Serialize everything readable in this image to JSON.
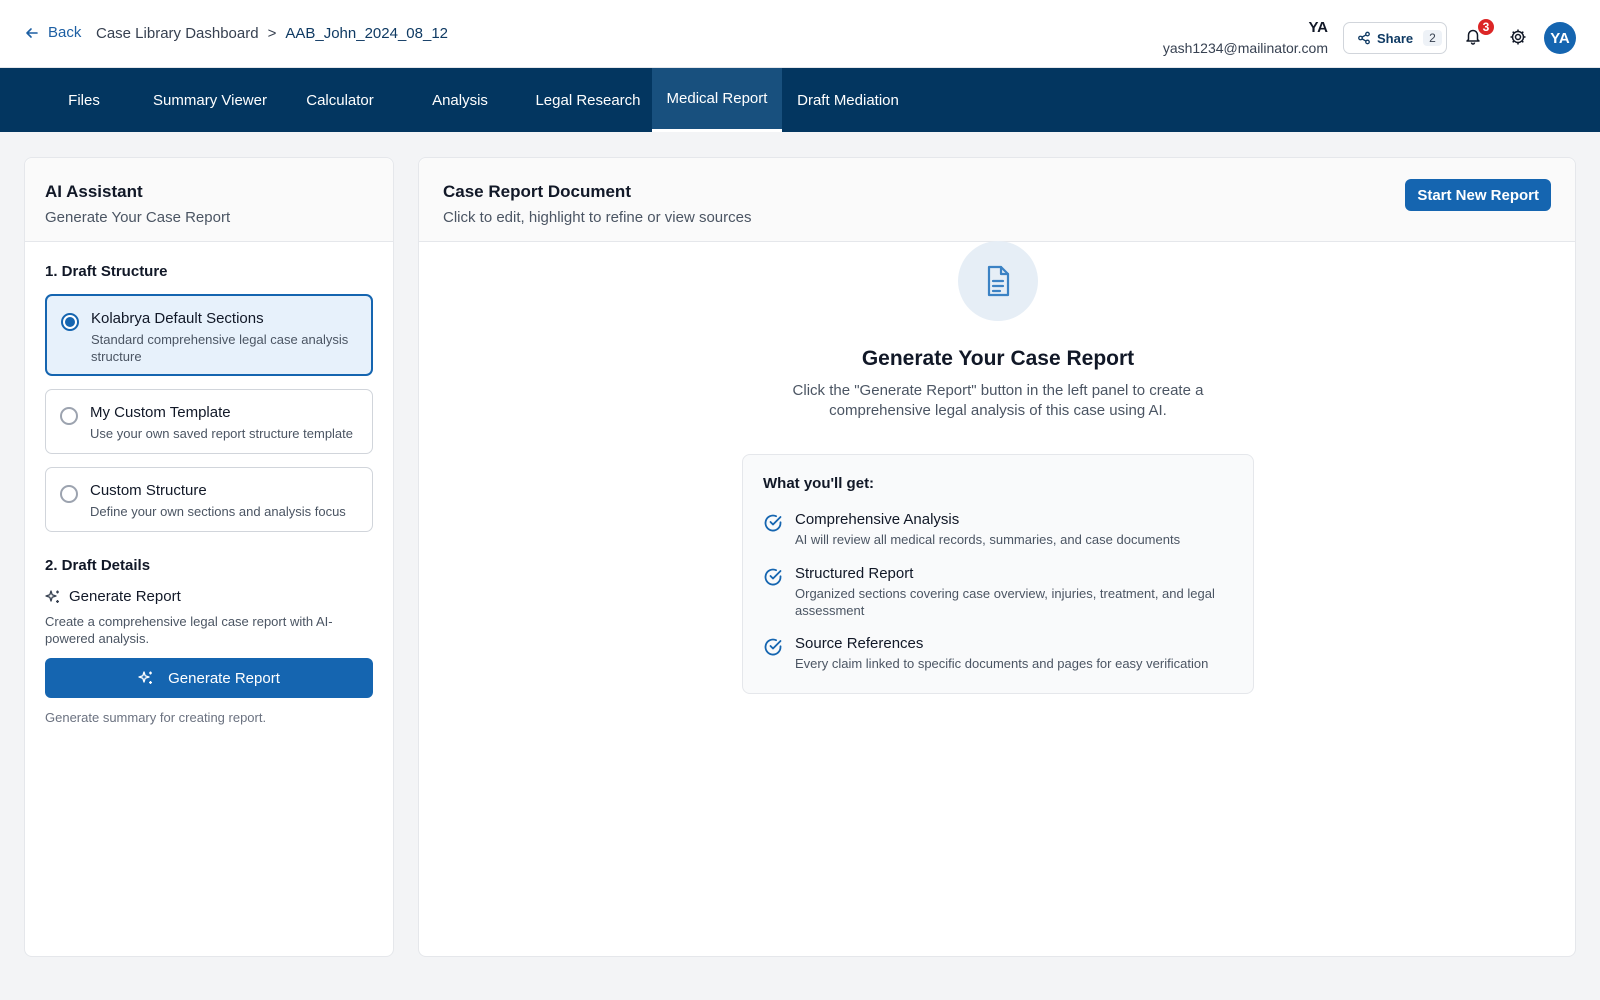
{
  "header": {
    "back_label": "Back",
    "breadcrumb_root": "Case Library Dashboard",
    "breadcrumb_sep": ">",
    "breadcrumb_current": "AAB_John_2024_08_12",
    "user_initials": "YA",
    "user_email": "yash1234@mailinator.com",
    "share_label": "Share",
    "share_count": "2",
    "notification_count": "3",
    "avatar_initials": "YA"
  },
  "tabs": [
    {
      "label": "Files"
    },
    {
      "label": "Summary Viewer"
    },
    {
      "label": "Calculator"
    },
    {
      "label": "Analysis"
    },
    {
      "label": "Legal Research"
    },
    {
      "label": "Medical Report",
      "active": true
    },
    {
      "label": "Draft Mediation"
    }
  ],
  "left_panel": {
    "title": "AI Assistant",
    "subtitle": "Generate Your Case Report",
    "section1_heading": "1. Draft Structure",
    "options": [
      {
        "title": "Kolabrya Default Sections",
        "description": "Standard comprehensive legal case analysis structure",
        "selected": true
      },
      {
        "title": "My Custom Template",
        "description": "Use your own saved report structure template",
        "selected": false
      },
      {
        "title": "Custom Structure",
        "description": "Define your own sections and analysis focus",
        "selected": false
      }
    ],
    "section2_heading": "2. Draft Details",
    "generate_heading": "Generate Report",
    "generate_description": "Create a comprehensive legal case report with AI-powered analysis.",
    "generate_button": "Generate Report",
    "generate_note": "Generate summary for creating report."
  },
  "right_panel": {
    "title": "Case Report Document",
    "subtitle": "Click to edit, highlight to refine or view sources",
    "new_report_button": "Start New Report",
    "empty_title": "Generate Your Case Report",
    "empty_description": "Click the \"Generate Report\" button in the left panel to create a comprehensive legal analysis of this case using AI.",
    "benefits_heading": "What you'll get:",
    "benefits": [
      {
        "title": "Comprehensive Analysis",
        "description": "AI will review all medical records, summaries, and case documents"
      },
      {
        "title": "Structured Report",
        "description": "Organized sections covering case overview, injuries, treatment, and legal assessment"
      },
      {
        "title": "Source References",
        "description": "Every claim linked to specific documents and pages for easy verification"
      }
    ]
  },
  "colors": {
    "primary": "#1565b0",
    "nav_bg": "#033660",
    "active_tab_bg": "#18507e",
    "badge": "#dc2626"
  }
}
